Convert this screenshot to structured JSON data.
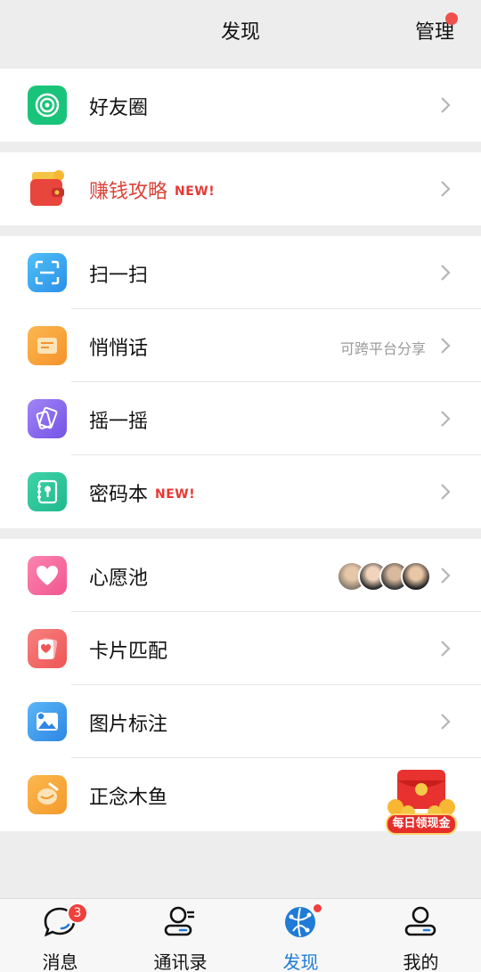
{
  "header": {
    "title": "发现",
    "manage": "管理"
  },
  "groups": {
    "moments": {
      "label": "好友圈",
      "icon": "moments-icon",
      "color": "#19c47a"
    },
    "earn": {
      "label": "赚钱攻略",
      "badge": "NEW!",
      "icon": "wallet-icon",
      "label_color": "#d9443a"
    },
    "tools": [
      {
        "label": "扫一扫",
        "icon": "scan-icon",
        "color": "#3aa7f0"
      },
      {
        "label": "悄悄话",
        "sub": "可跨平台分享",
        "icon": "whisper-icon",
        "color": "#f7a23a"
      },
      {
        "label": "摇一摇",
        "icon": "shake-icon",
        "color": "#8b6cf0"
      },
      {
        "label": "密码本",
        "badge": "NEW!",
        "icon": "password-book-icon",
        "color": "#27c59a"
      }
    ],
    "fun": [
      {
        "label": "心愿池",
        "icon": "heart-icon",
        "color": "#f5679b"
      },
      {
        "label": "卡片匹配",
        "icon": "card-match-icon",
        "color": "#f06a6a"
      },
      {
        "label": "图片标注",
        "icon": "image-tag-icon",
        "color": "#3a9cf0"
      },
      {
        "label": "正念木鱼",
        "icon": "wooden-fish-icon",
        "color": "#f7a23a"
      }
    ]
  },
  "promo": {
    "label": "每日领现金"
  },
  "tabs": [
    {
      "label": "消息",
      "badge": "3",
      "icon": "chat-icon"
    },
    {
      "label": "通讯录",
      "icon": "contacts-icon"
    },
    {
      "label": "发现",
      "icon": "discover-icon",
      "active": true
    },
    {
      "label": "我的",
      "icon": "profile-icon"
    }
  ],
  "colors": {
    "accent": "#1f7bd6",
    "badge_red": "#f0403c",
    "new_red": "#e53935"
  }
}
